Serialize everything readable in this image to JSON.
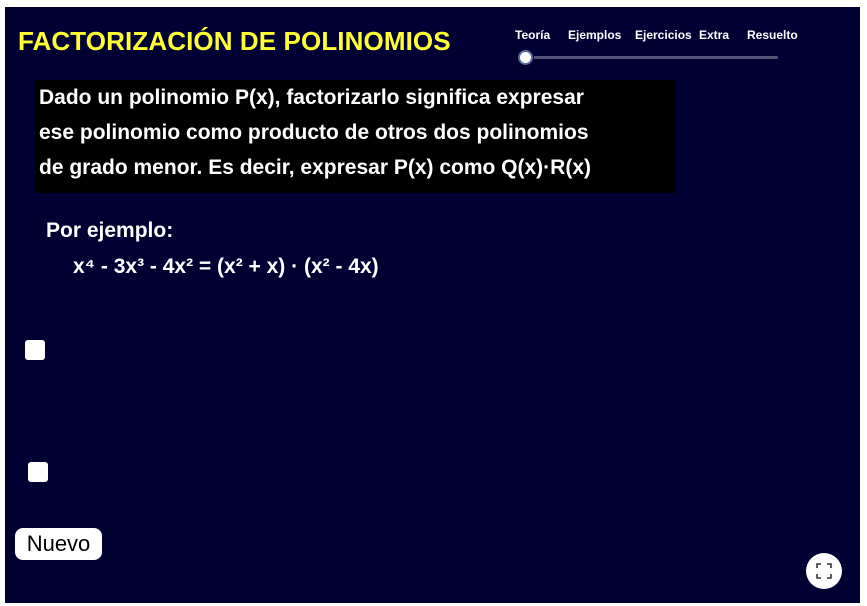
{
  "header": {
    "title": "FACTORIZACIÓN DE POLINOMIOS"
  },
  "tabs": [
    {
      "label": "Teoría"
    },
    {
      "label": "Ejemplos"
    },
    {
      "label": "Ejercicios"
    },
    {
      "label": "Extra"
    },
    {
      "label": "Resuelto"
    }
  ],
  "slider": {
    "selected_index": 0,
    "selected_label": "Teoría"
  },
  "definition": {
    "lines": [
      "Dado un polinomio P(x), factorizarlo significa expresar",
      "ese polinomio como producto de otros dos polinomios",
      "de grado menor. Es decir, expresar P(x) como Q(x)·R(x)"
    ]
  },
  "example": {
    "label": "Por ejemplo:",
    "equation": "x⁴ - 3x³ - 4x² = (x² + x) · (x² - 4x)"
  },
  "checkboxes": [
    {
      "checked": false
    },
    {
      "checked": false
    }
  ],
  "buttons": {
    "nuevo_label": "Nuevo",
    "fullscreen_icon": "fullscreen-icon"
  },
  "colors": {
    "background": "#000033",
    "title": "#ffff33",
    "text": "#ffffff",
    "definition_background": "#000000"
  }
}
